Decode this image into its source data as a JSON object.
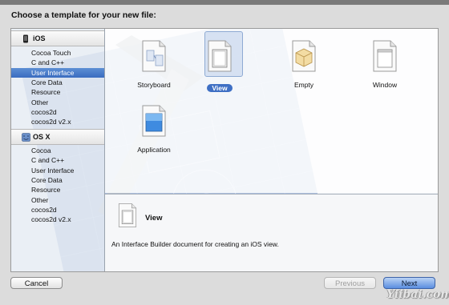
{
  "dialog": {
    "title": "Choose a template for your new file:"
  },
  "sidebar": {
    "groups": [
      {
        "label": "iOS",
        "icon": "ios-device-icon",
        "items": [
          "Cocoa Touch",
          "C and C++",
          "User Interface",
          "Core Data",
          "Resource",
          "Other",
          "cocos2d",
          "cocos2d v2.x"
        ],
        "selected_index": 2
      },
      {
        "label": "OS X",
        "icon": "osx-finder-icon",
        "items": [
          "Cocoa",
          "C and C++",
          "User Interface",
          "Core Data",
          "Resource",
          "Other",
          "cocos2d",
          "cocos2d v2.x"
        ],
        "selected_index": -1
      }
    ]
  },
  "templates": [
    {
      "label": "Storyboard",
      "icon": "storyboard-icon",
      "selected": false
    },
    {
      "label": "View",
      "icon": "view-icon",
      "selected": true
    },
    {
      "label": "Empty",
      "icon": "empty-icon",
      "selected": false
    },
    {
      "label": "Window",
      "icon": "window-icon",
      "selected": false
    },
    {
      "label": "Application",
      "icon": "application-icon",
      "selected": false
    }
  ],
  "description": {
    "title": "View",
    "text": "An Interface Builder document for creating an iOS view.",
    "icon": "view-icon"
  },
  "buttons": {
    "cancel": "Cancel",
    "previous": "Previous",
    "next": "Next"
  },
  "watermark": "Yiibai.com",
  "colors": {
    "selection": "#3e6fc4",
    "next_button": "#5a8ee0"
  }
}
